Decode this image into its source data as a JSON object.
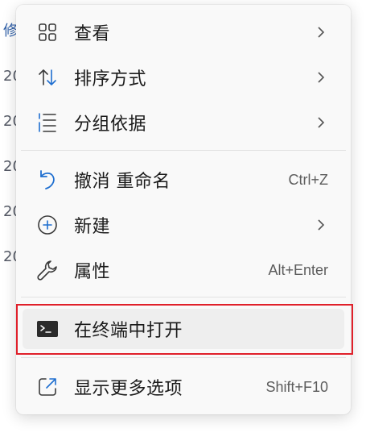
{
  "background": {
    "fragments": [
      "修",
      "20",
      "20",
      "20",
      "20",
      "20"
    ]
  },
  "menu": {
    "items": [
      {
        "label": "查看",
        "icon": "grid-icon",
        "submenu": true
      },
      {
        "label": "排序方式",
        "icon": "sort-icon",
        "submenu": true
      },
      {
        "label": "分组依据",
        "icon": "group-list-icon",
        "submenu": true
      },
      {
        "label": "撤消 重命名",
        "icon": "undo-icon",
        "shortcut": "Ctrl+Z"
      },
      {
        "label": "新建",
        "icon": "plus-circle-icon",
        "submenu": true
      },
      {
        "label": "属性",
        "icon": "wrench-icon",
        "shortcut": "Alt+Enter"
      },
      {
        "label": "在终端中打开",
        "icon": "terminal-icon"
      },
      {
        "label": "显示更多选项",
        "icon": "open-external-icon",
        "shortcut": "Shift+F10"
      }
    ]
  },
  "colors": {
    "menu_bg": "#f9f9f9",
    "accent": "#1f6fd0",
    "highlight_box": "#e0202a"
  }
}
